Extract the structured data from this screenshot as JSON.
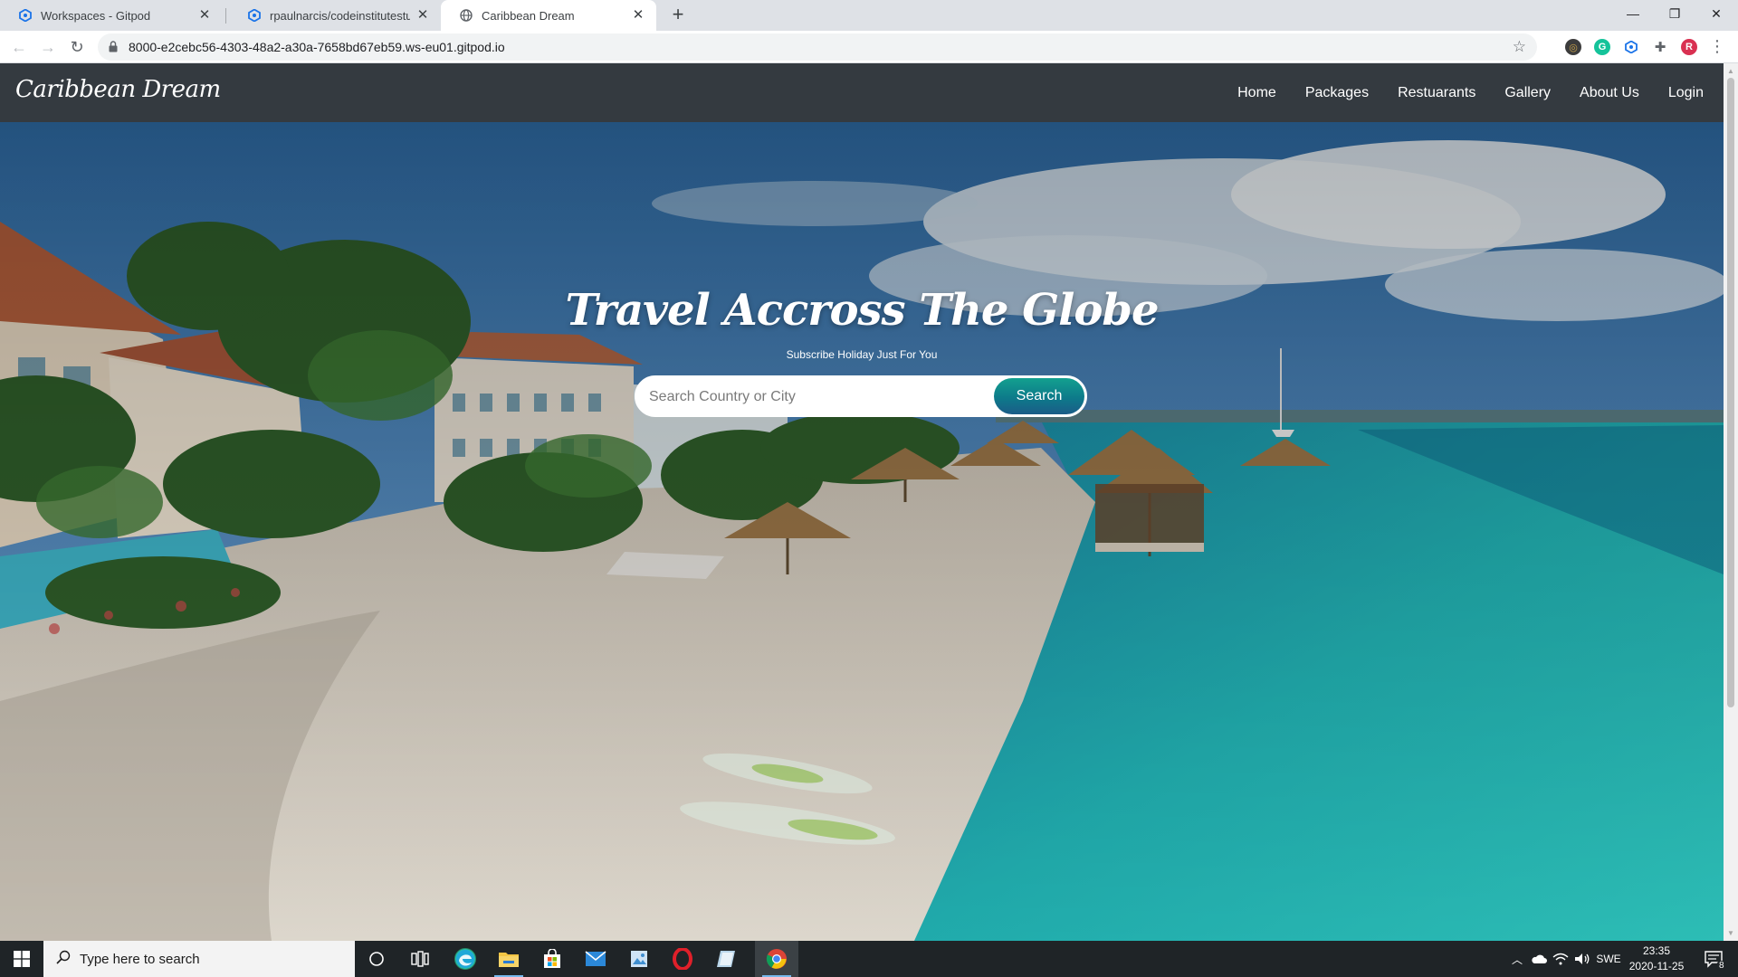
{
  "browser": {
    "tabs": [
      {
        "title": "Workspaces - Gitpod",
        "active": false
      },
      {
        "title": "rpaulnarcis/codeinstitutestudent",
        "active": false
      },
      {
        "title": "Caribbean Dream",
        "active": true
      }
    ],
    "url": "8000-e2cebc56-4303-48a2-a30a-7658bd67eb59.ws-eu01.gitpod.io",
    "profile_initial": "R"
  },
  "site": {
    "brand": "Caribbean Dream",
    "nav": [
      "Home",
      "Packages",
      "Restuarants",
      "Gallery",
      "About Us",
      "Login"
    ],
    "hero": {
      "title": "Travel Accross The Globe",
      "subtitle": "Subscribe Holiday Just For You",
      "search_placeholder": "Search Country or City",
      "search_button": "Search"
    }
  },
  "taskbar": {
    "search_placeholder": "Type here to search",
    "language": "SWE",
    "time": "23:35",
    "date": "2020-11-25",
    "notification_count": "8"
  },
  "colors": {
    "navbar": "#343a40",
    "tabstrip": "#dee1e6",
    "search_button_start": "#13a08f",
    "search_button_end": "#1b5c88",
    "taskbar": "#1f2427"
  }
}
